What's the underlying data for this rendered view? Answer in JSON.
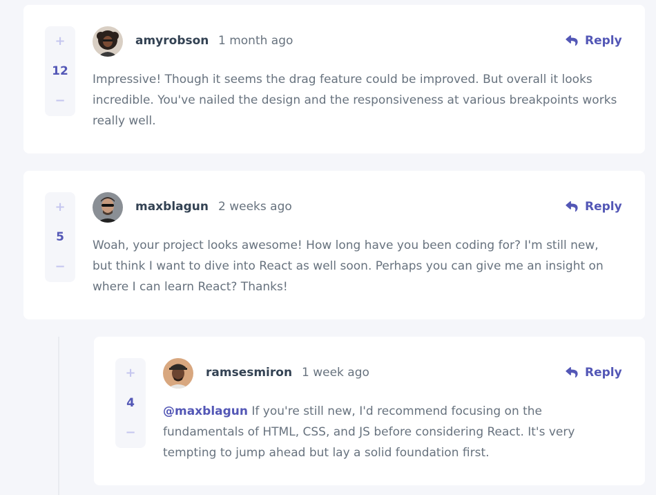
{
  "comments": [
    {
      "username": "amyrobson",
      "time": "1 month ago",
      "score": "12",
      "content": "Impressive! Though it seems the drag feature could be improved. But overall it looks incredible. You've nailed the design and the responsiveness at various breakpoints works really well.",
      "reply_label": "Reply",
      "plus": "+",
      "minus": "−"
    },
    {
      "username": "maxblagun",
      "time": "2 weeks ago",
      "score": "5",
      "content": "Woah, your project looks awesome! How long have you been coding for? I'm still new, but think I want to dive into React as well soon. Perhaps you can give me an insight on where I can learn React? Thanks!",
      "reply_label": "Reply",
      "plus": "+",
      "minus": "−"
    }
  ],
  "replies": [
    {
      "username": "ramsesmiron",
      "time": "1 week ago",
      "score": "4",
      "mention": "@maxblagun",
      "content": " If you're still new, I'd recommend focusing on the fundamentals of HTML, CSS, and JS before considering React. It's very tempting to jump ahead but lay a solid foundation first.",
      "reply_label": "Reply",
      "plus": "+",
      "minus": "−"
    }
  ],
  "colors": {
    "primary": "#5357b6",
    "light_primary": "#c5c6ef",
    "heading": "#334253",
    "text": "#67727e",
    "background": "#f5f6fa",
    "card": "#ffffff"
  }
}
